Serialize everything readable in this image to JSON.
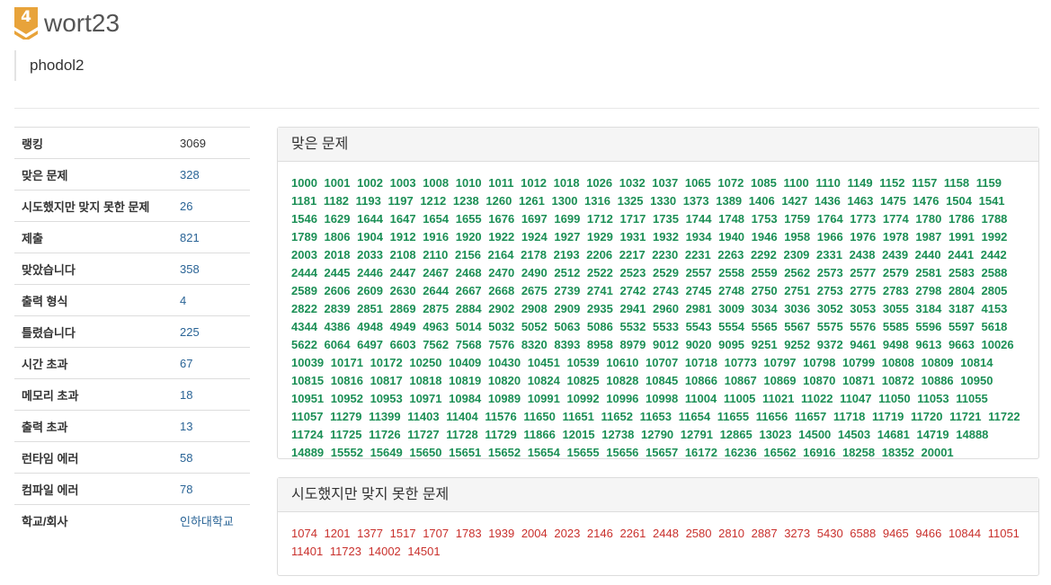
{
  "profile": {
    "tier_number": "4",
    "tier_color": "#e8a33a",
    "username": "wort23",
    "status_message": "phodol2"
  },
  "stats": [
    {
      "label": "랭킹",
      "value": "3069",
      "link": false
    },
    {
      "label": "맞은 문제",
      "value": "328",
      "link": true
    },
    {
      "label": "시도했지만 맞지 못한 문제",
      "value": "26",
      "link": true
    },
    {
      "label": "제출",
      "value": "821",
      "link": true
    },
    {
      "label": "맞았습니다",
      "value": "358",
      "link": true
    },
    {
      "label": "출력 형식",
      "value": "4",
      "link": true
    },
    {
      "label": "틀렸습니다",
      "value": "225",
      "link": true
    },
    {
      "label": "시간 초과",
      "value": "67",
      "link": true
    },
    {
      "label": "메모리 초과",
      "value": "18",
      "link": true
    },
    {
      "label": "출력 초과",
      "value": "13",
      "link": true
    },
    {
      "label": "런타임 에러",
      "value": "58",
      "link": true
    },
    {
      "label": "컴파일 에러",
      "value": "78",
      "link": true
    },
    {
      "label": "학교/회사",
      "value": "인하대학교",
      "link": true
    }
  ],
  "solved_panel": {
    "title": "맞은 문제",
    "color": "#1b8f55",
    "problems": [
      "1000",
      "1001",
      "1002",
      "1003",
      "1008",
      "1010",
      "1011",
      "1012",
      "1018",
      "1026",
      "1032",
      "1037",
      "1065",
      "1072",
      "1085",
      "1100",
      "1110",
      "1149",
      "1152",
      "1157",
      "1158",
      "1159",
      "1181",
      "1182",
      "1193",
      "1197",
      "1212",
      "1238",
      "1260",
      "1261",
      "1300",
      "1316",
      "1325",
      "1330",
      "1373",
      "1389",
      "1406",
      "1427",
      "1436",
      "1463",
      "1475",
      "1476",
      "1504",
      "1541",
      "1546",
      "1629",
      "1644",
      "1647",
      "1654",
      "1655",
      "1676",
      "1697",
      "1699",
      "1712",
      "1717",
      "1735",
      "1744",
      "1748",
      "1753",
      "1759",
      "1764",
      "1773",
      "1774",
      "1780",
      "1786",
      "1788",
      "1789",
      "1806",
      "1904",
      "1912",
      "1916",
      "1920",
      "1922",
      "1924",
      "1927",
      "1929",
      "1931",
      "1932",
      "1934",
      "1940",
      "1946",
      "1958",
      "1966",
      "1976",
      "1978",
      "1987",
      "1991",
      "1992",
      "2003",
      "2018",
      "2033",
      "2108",
      "2110",
      "2156",
      "2164",
      "2178",
      "2193",
      "2206",
      "2217",
      "2230",
      "2231",
      "2263",
      "2292",
      "2309",
      "2331",
      "2438",
      "2439",
      "2440",
      "2441",
      "2442",
      "2444",
      "2445",
      "2446",
      "2447",
      "2467",
      "2468",
      "2470",
      "2490",
      "2512",
      "2522",
      "2523",
      "2529",
      "2557",
      "2558",
      "2559",
      "2562",
      "2573",
      "2577",
      "2579",
      "2581",
      "2583",
      "2588",
      "2589",
      "2606",
      "2609",
      "2630",
      "2644",
      "2667",
      "2668",
      "2675",
      "2739",
      "2741",
      "2742",
      "2743",
      "2745",
      "2748",
      "2750",
      "2751",
      "2753",
      "2775",
      "2783",
      "2798",
      "2804",
      "2805",
      "2822",
      "2839",
      "2851",
      "2869",
      "2875",
      "2884",
      "2902",
      "2908",
      "2909",
      "2935",
      "2941",
      "2960",
      "2981",
      "3009",
      "3034",
      "3036",
      "3052",
      "3053",
      "3055",
      "3184",
      "3187",
      "4153",
      "4344",
      "4386",
      "4948",
      "4949",
      "4963",
      "5014",
      "5032",
      "5052",
      "5063",
      "5086",
      "5532",
      "5533",
      "5543",
      "5554",
      "5565",
      "5567",
      "5575",
      "5576",
      "5585",
      "5596",
      "5597",
      "5618",
      "5622",
      "6064",
      "6497",
      "6603",
      "7562",
      "7568",
      "7576",
      "8320",
      "8393",
      "8958",
      "8979",
      "9012",
      "9020",
      "9095",
      "9251",
      "9252",
      "9372",
      "9461",
      "9498",
      "9613",
      "9663",
      "10026",
      "10039",
      "10171",
      "10172",
      "10250",
      "10409",
      "10430",
      "10451",
      "10539",
      "10610",
      "10707",
      "10718",
      "10773",
      "10797",
      "10798",
      "10799",
      "10808",
      "10809",
      "10814",
      "10815",
      "10816",
      "10817",
      "10818",
      "10819",
      "10820",
      "10824",
      "10825",
      "10828",
      "10845",
      "10866",
      "10867",
      "10869",
      "10870",
      "10871",
      "10872",
      "10886",
      "10950",
      "10951",
      "10952",
      "10953",
      "10971",
      "10984",
      "10989",
      "10991",
      "10992",
      "10996",
      "10998",
      "11004",
      "11005",
      "11021",
      "11022",
      "11047",
      "11050",
      "11053",
      "11055",
      "11057",
      "11279",
      "11399",
      "11403",
      "11404",
      "11576",
      "11650",
      "11651",
      "11652",
      "11653",
      "11654",
      "11655",
      "11656",
      "11657",
      "11718",
      "11719",
      "11720",
      "11721",
      "11722",
      "11724",
      "11725",
      "11726",
      "11727",
      "11728",
      "11729",
      "11866",
      "12015",
      "12738",
      "12790",
      "12791",
      "12865",
      "13023",
      "14500",
      "14503",
      "14681",
      "14719",
      "14888",
      "14889",
      "15552",
      "15649",
      "15650",
      "15651",
      "15652",
      "15654",
      "15655",
      "15656",
      "15657",
      "16172",
      "16236",
      "16562",
      "16916",
      "18258",
      "18352",
      "20001"
    ]
  },
  "failed_panel": {
    "title": "시도했지만 맞지 못한 문제",
    "color": "#c9302c",
    "problems": [
      "1074",
      "1201",
      "1377",
      "1517",
      "1707",
      "1783",
      "1939",
      "2004",
      "2023",
      "2146",
      "2261",
      "2448",
      "2580",
      "2810",
      "2887",
      "3273",
      "5430",
      "6588",
      "9465",
      "9466",
      "10844",
      "11051",
      "11401",
      "11723",
      "14002",
      "14501"
    ]
  }
}
